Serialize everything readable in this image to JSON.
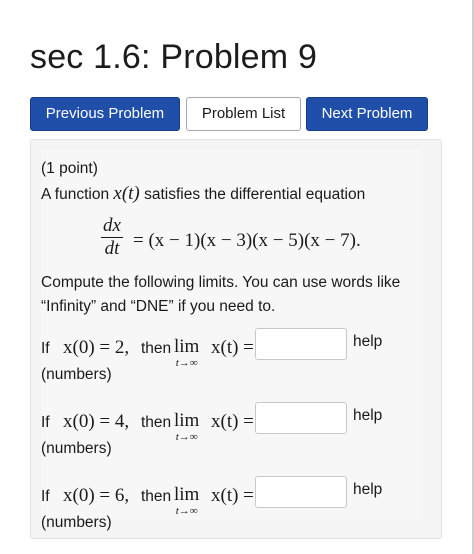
{
  "header": {
    "title": "sec 1.6: Problem 9"
  },
  "nav": {
    "previous_label": "Previous Problem",
    "list_label": "Problem List",
    "next_label": "Next Problem"
  },
  "problem": {
    "points": "(1 point)",
    "intro_text": "A function",
    "intro_func": "x(t)",
    "intro_rest": "satisfies the differential equation",
    "eq_numerator": "dx",
    "eq_denominator": "dt",
    "eq_rhs": "= (x − 1)(x − 3)(x − 5)(x − 7).",
    "instructions_line1": "Compute the following limits. You can use words like",
    "instructions_line2": "“Infinity” and “DNE” if you need to.",
    "parts": [
      {
        "prefix": "If",
        "condition": "x(0) = 2,",
        "then": "then",
        "lim": "lim",
        "lim_sub": "t→∞",
        "lim_expr": "x(t) =",
        "answer_value": "",
        "help_label": "help",
        "type_label": "(numbers)"
      },
      {
        "prefix": "If",
        "condition": "x(0) = 4,",
        "then": "then",
        "lim": "lim",
        "lim_sub": "t→∞",
        "lim_expr": "x(t) =",
        "answer_value": "",
        "help_label": "help",
        "type_label": "(numbers)"
      },
      {
        "prefix": "If",
        "condition": "x(0) = 6,",
        "then": "then",
        "lim": "lim",
        "lim_sub": "t→∞",
        "lim_expr": "x(t) =",
        "answer_value": "",
        "help_label": "help",
        "type_label": "(numbers)"
      }
    ]
  },
  "colors": {
    "primary_button": "#1f4fa8",
    "panel_background": "#f4f4f4"
  }
}
